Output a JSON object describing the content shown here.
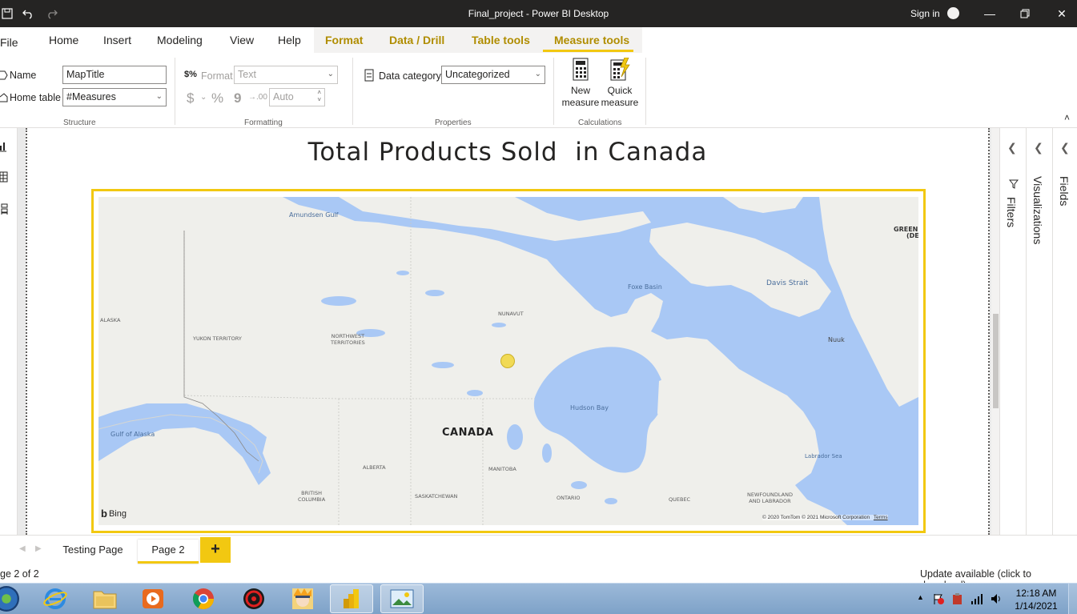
{
  "window": {
    "title": "Final_project - Power BI Desktop",
    "sign_in": "Sign in"
  },
  "ribbon_tabs": [
    {
      "label": "File"
    },
    {
      "label": "Home"
    },
    {
      "label": "Insert"
    },
    {
      "label": "Modeling"
    },
    {
      "label": "View"
    },
    {
      "label": "Help"
    },
    {
      "label": "Format"
    },
    {
      "label": "Data / Drill"
    },
    {
      "label": "Table tools"
    },
    {
      "label": "Measure tools"
    }
  ],
  "structure": {
    "name_label": "Name",
    "name_value": "MapTitle",
    "home_table_label": "Home table",
    "home_table_value": "#Measures",
    "group_label": "Structure"
  },
  "formatting": {
    "format_label": "Format",
    "format_value": "Text",
    "currency_symbol": "$",
    "percent_symbol": "%",
    "comma_symbol": "9",
    "decimals_value": "Auto",
    "group_label": "Formatting"
  },
  "properties": {
    "data_category_label": "Data category",
    "data_category_value": "Uncategorized",
    "group_label": "Properties"
  },
  "calculations": {
    "new_measure_line1": "New",
    "new_measure_line2": "measure",
    "quick_measure_line1": "Quick",
    "quick_measure_line2": "measure",
    "group_label": "Calculations"
  },
  "report": {
    "title": "Total Products Sold  in Canada",
    "map_labels": {
      "amundsen_gulf": "Amundsen Gulf",
      "alaska": "ALASKA",
      "yukon": "YUKON TERRITORY",
      "nwt_line1": "NORTHWEST",
      "nwt_line2": "TERRITORIES",
      "nunavut": "NUNAVUT",
      "foxe_basin": "Foxe Basin",
      "davis_strait": "Davis Strait",
      "nuuk": "Nuuk",
      "greenland_line1": "GREEN",
      "greenland_line2": "(DE",
      "gulf_of_alaska": "Gulf of Alaska",
      "canada": "CANADA",
      "hudson_bay": "Hudson Bay",
      "alberta": "ALBERTA",
      "manitoba": "MANITOBA",
      "saskatchewan": "SASKATCHEWAN",
      "bc_line1": "BRITISH",
      "bc_line2": "COLUMBIA",
      "ontario": "ONTARIO",
      "quebec": "QUEBEC",
      "nl_line1": "NEWFOUNDLAND",
      "nl_line2": "AND LABRADOR",
      "labrador_sea": "Labrador Sea"
    },
    "bing": "Bing",
    "attribution": "© 2020 TomTom © 2021 Microsoft Corporation",
    "terms": "Terms"
  },
  "panes": {
    "filters": "Filters",
    "visualizations": "Visualizations",
    "fields": "Fields"
  },
  "page_tabs": [
    {
      "label": "Testing Page"
    },
    {
      "label": "Page 2"
    }
  ],
  "add_page": "+",
  "status": {
    "page_info": "ge 2 of 2",
    "update": "Update available (click to download)"
  },
  "taskbar": {
    "time": "12:18 AM",
    "date": "1/14/2021"
  },
  "colors": {
    "accent": "#f2c811",
    "titlebar": "#252423",
    "water": "#a9c8f5",
    "land": "#efefeb"
  }
}
